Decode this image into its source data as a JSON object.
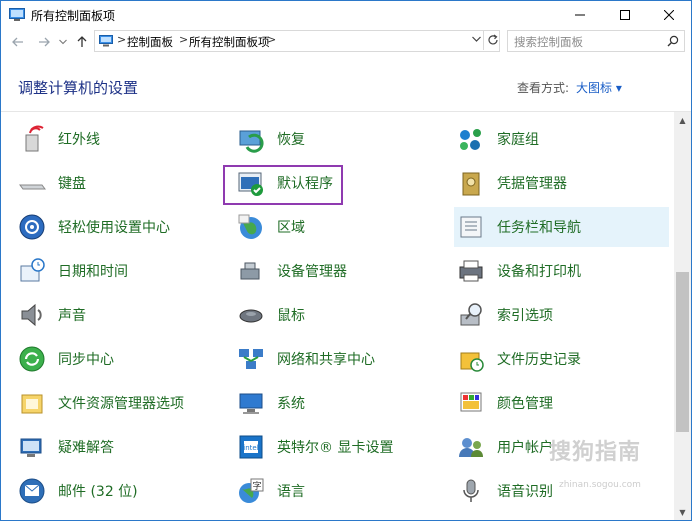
{
  "window": {
    "title": "所有控制面板项",
    "controls": {
      "minimize": "—",
      "maximize": "☐",
      "close": "✕"
    }
  },
  "navigation": {
    "back_icon": "arrow-left",
    "forward_icon": "arrow-right",
    "recent_icon": "chevron-down",
    "up_icon": "arrow-up",
    "breadcrumb": [
      "控制面板",
      "所有控制面板项"
    ],
    "separator": ">",
    "refresh_icon": "refresh",
    "search": {
      "placeholder": "搜索控制面板"
    }
  },
  "header": {
    "heading": "调整计算机的设置",
    "view_by_label": "查看方式:",
    "view_by_value": "大图标 ▾"
  },
  "items": [
    {
      "label": "红外线",
      "icon": "infrared-icon"
    },
    {
      "label": "恢复",
      "icon": "recovery-icon"
    },
    {
      "label": "家庭组",
      "icon": "homegroup-icon"
    },
    {
      "label": "键盘",
      "icon": "keyboard-icon"
    },
    {
      "label": "默认程序",
      "icon": "default-programs-icon"
    },
    {
      "label": "凭据管理器",
      "icon": "credential-manager-icon"
    },
    {
      "label": "轻松使用设置中心",
      "icon": "ease-of-access-icon"
    },
    {
      "label": "区域",
      "icon": "region-icon"
    },
    {
      "label": "任务栏和导航",
      "icon": "taskbar-icon"
    },
    {
      "label": "日期和时间",
      "icon": "date-time-icon"
    },
    {
      "label": "设备管理器",
      "icon": "device-manager-icon"
    },
    {
      "label": "设备和打印机",
      "icon": "printer-icon"
    },
    {
      "label": "声音",
      "icon": "sound-icon"
    },
    {
      "label": "鼠标",
      "icon": "mouse-icon"
    },
    {
      "label": "索引选项",
      "icon": "indexing-icon"
    },
    {
      "label": "同步中心",
      "icon": "sync-icon"
    },
    {
      "label": "网络和共享中心",
      "icon": "network-icon"
    },
    {
      "label": "文件历史记录",
      "icon": "file-history-icon"
    },
    {
      "label": "文件资源管理器选项",
      "icon": "folder-options-icon"
    },
    {
      "label": "系统",
      "icon": "system-icon"
    },
    {
      "label": "颜色管理",
      "icon": "color-management-icon"
    },
    {
      "label": "疑难解答",
      "icon": "troubleshooting-icon"
    },
    {
      "label": "英特尔® 显卡设置",
      "icon": "intel-graphics-icon"
    },
    {
      "label": "用户帐户",
      "icon": "user-accounts-icon"
    },
    {
      "label": "邮件 (32 位)",
      "icon": "mail-icon"
    },
    {
      "label": "语言",
      "icon": "language-icon"
    },
    {
      "label": "语音识别",
      "icon": "speech-icon"
    }
  ],
  "watermark": {
    "text": "搜狗指南",
    "url": "zhinan.sogou.com"
  },
  "colors": {
    "heading": "#1e3287",
    "link": "#1f6c25",
    "view_value": "#1a5ec7",
    "selected_bg": "#e5f3fb",
    "highlight_border": "#8f3ab0",
    "window_border": "#2b78c9"
  }
}
